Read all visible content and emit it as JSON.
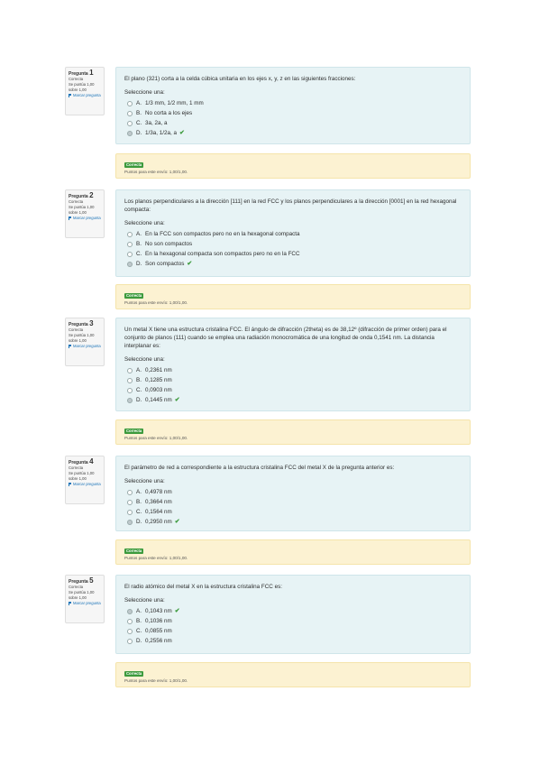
{
  "common": {
    "select_prompt": "Seleccione una:",
    "status": "Correcta",
    "flag_label": "Marcar pregunta",
    "badge": "Correcta"
  },
  "questions": [
    {
      "label": "Pregunta",
      "number": "1",
      "points": "Se puntúa 1,00 sobre 1,00",
      "text": "El plano (321) corta a la celda cúbica unitaria en los ejes x, y, z en las siguientes fracciones:",
      "answers": [
        {
          "letter": "A.",
          "text": "1/3 mm, 1/2 mm, 1 mm",
          "checked": false
        },
        {
          "letter": "B.",
          "text": "No corta a los ejes",
          "checked": false
        },
        {
          "letter": "C.",
          "text": "3a, 2a, a",
          "checked": false
        },
        {
          "letter": "D.",
          "text": "1/3a, 1/2a, a",
          "checked": true
        }
      ],
      "feedback": "Puntos para este envío: 1,00/1,00."
    },
    {
      "label": "Pregunta",
      "number": "2",
      "points": "Se puntúa 1,00 sobre 1,00",
      "text": "Los planos perpendiculares a la dirección [111] en la red FCC y los planos perpendiculares a la dirección [0001] en la red hexagonal compacta:",
      "answers": [
        {
          "letter": "A.",
          "text": "En la FCC son compactos pero no en la hexagonal compacta",
          "checked": false
        },
        {
          "letter": "B.",
          "text": "No son compactos",
          "checked": false
        },
        {
          "letter": "C.",
          "text": "En la hexagonal compacta son compactos pero no en la FCC",
          "checked": false
        },
        {
          "letter": "D.",
          "text": "Son compactos",
          "checked": true
        }
      ],
      "feedback": "Puntos para este envío: 1,00/1,00."
    },
    {
      "label": "Pregunta",
      "number": "3",
      "points": "Se puntúa 1,00 sobre 1,00",
      "text": "Un metal X tiene una estructura cristalina FCC. El ángulo de difracción (2theta) es de 38,12º (difracción de primer orden) para el conjunto de planos (111) cuando se emplea una radiación monocromática de una longitud de onda 0,1541 nm. La distancia interplanar es:",
      "answers": [
        {
          "letter": "A.",
          "text": "0,2361 nm",
          "checked": false
        },
        {
          "letter": "B.",
          "text": "0,1285 nm",
          "checked": false
        },
        {
          "letter": "C.",
          "text": "0,0903 nm",
          "checked": false
        },
        {
          "letter": "D.",
          "text": "0,1445 nm",
          "checked": true
        }
      ],
      "feedback": "Puntos para este envío: 1,00/1,00."
    },
    {
      "label": "Pregunta",
      "number": "4",
      "points": "Se puntúa 1,00 sobre 1,00",
      "text": "El parámetro de red a correspondiente a la estructura cristalina FCC del metal X de la pregunta anterior es:",
      "answers": [
        {
          "letter": "A.",
          "text": "0,4978 nm",
          "checked": false
        },
        {
          "letter": "B.",
          "text": "0,3664 nm",
          "checked": false
        },
        {
          "letter": "C.",
          "text": "0,1564 nm",
          "checked": false
        },
        {
          "letter": "D.",
          "text": "0,2950 nm",
          "checked": true
        }
      ],
      "feedback": "Puntos para este envío: 1,00/1,00."
    },
    {
      "label": "Pregunta",
      "number": "5",
      "points": "Se puntúa 1,00 sobre 1,00",
      "text": "El radio atómico del metal X en la estructura cristalina FCC es:",
      "answers": [
        {
          "letter": "A.",
          "text": "0,1043 nm",
          "checked": true
        },
        {
          "letter": "B.",
          "text": "0,1036 nm",
          "checked": false
        },
        {
          "letter": "C.",
          "text": "0,0855 nm",
          "checked": false
        },
        {
          "letter": "D.",
          "text": "0,2556 nm",
          "checked": false
        }
      ],
      "feedback": "Puntos para este envío: 1,00/1,00."
    }
  ]
}
